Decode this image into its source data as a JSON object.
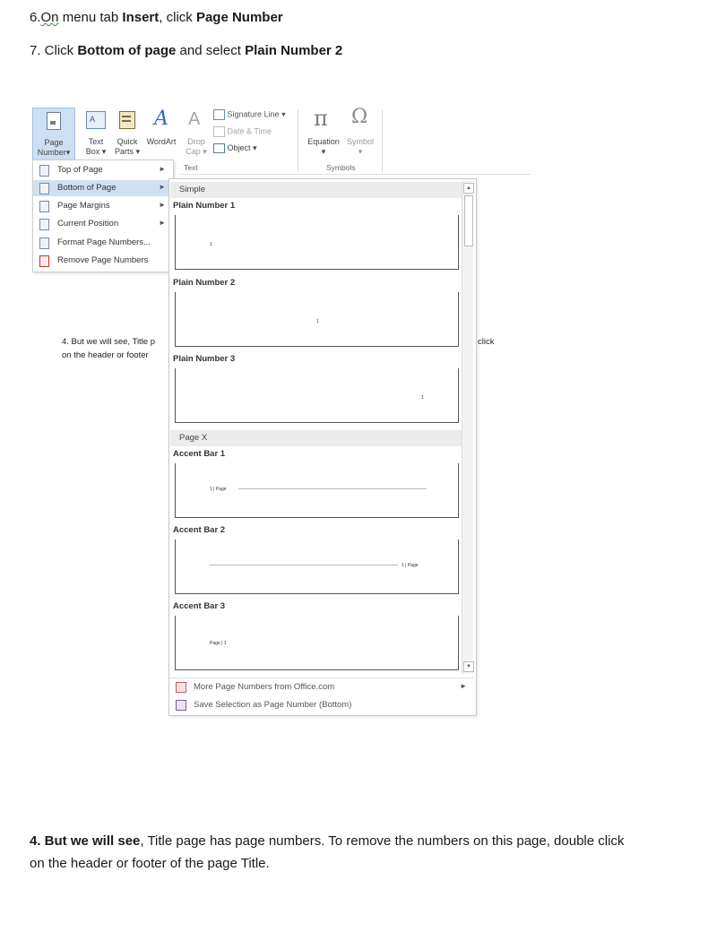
{
  "steps": {
    "step6_prefix": "6.",
    "step6_on": "On",
    "step6_mid": " menu tab ",
    "step6_insert": "Insert",
    "step6_click": ", click ",
    "step6_target": "Page Number",
    "step7_prefix": "7. Click ",
    "step7_bottom": "Bottom of page",
    "step7_mid": " and select ",
    "step7_target": "Plain Number 2"
  },
  "ribbon": {
    "page_number_line1": "Page",
    "page_number_line2": "Number",
    "text_box_line1": "Text",
    "text_box_line2": "Box",
    "quick_parts_line1": "Quick",
    "quick_parts_line2": "Parts",
    "wordart": "WordArt",
    "drop_cap_line1": "Drop",
    "drop_cap_line2": "Cap",
    "signature_line": "Signature Line",
    "date_time": "Date & Time",
    "object": "Object",
    "equation": "Equation",
    "symbol": "Symbol",
    "group_text": "Text",
    "group_symbols": "Symbols",
    "pi_glyph": "π",
    "omega_glyph": "Ω",
    "wordart_glyph": "A"
  },
  "menu": {
    "items": [
      {
        "label": "Top of Page"
      },
      {
        "label": "Bottom of Page"
      },
      {
        "label": "Page Margins"
      },
      {
        "label": "Current Position"
      },
      {
        "label": "Format Page Numbers..."
      },
      {
        "label": "Remove Page Numbers"
      }
    ]
  },
  "gallery": {
    "section_simple": "Simple",
    "section_pagex": "Page X",
    "plain1": "Plain Number 1",
    "plain2": "Plain Number 2",
    "plain3": "Plain Number 3",
    "accent1": "Accent Bar 1",
    "accent2": "Accent Bar 2",
    "accent3": "Accent Bar 3",
    "thumb_num": "1",
    "accent1_text": "1 | Page",
    "accent2_text": "1 | Page",
    "accent3_text": "Page | 1",
    "more": "More Page Numbers from Office.com",
    "save": "Save Selection as Page Number (Bottom)"
  },
  "obscured": {
    "line1": "4. But we will see, Title p",
    "line1_right": "click",
    "line2": "on the header or footer"
  },
  "bottom_text": {
    "line1_prefix": "4. But we will see",
    "line1_rest": ", Title page has page numbers. To remove the numbers on this page, double click",
    "line2": "on the header or footer of the page Title."
  }
}
